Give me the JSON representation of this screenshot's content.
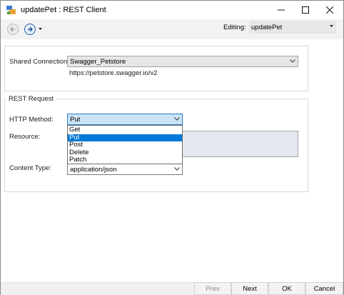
{
  "window": {
    "title": "updatePet : REST Client",
    "controls": {
      "minimize": "—",
      "maximize": "☐",
      "close": "✕"
    }
  },
  "toolbar": {
    "editing_label": "Editing:",
    "editing_value": "updatePet"
  },
  "connection": {
    "label": "Shared Connection:",
    "value": "Swagger_Petstore",
    "url": "https://petstore.swagger.io/v2"
  },
  "rest_request": {
    "title": "REST Request",
    "http_method_label": "HTTP Method:",
    "http_method_value": "Put",
    "resource_label": "Resource:",
    "content_type_label": "Content Type:",
    "content_type_value": "application/json",
    "method_options": [
      "Get",
      "Put",
      "Post",
      "Delete",
      "Patch"
    ],
    "selected_option_index": 1
  },
  "buttons": {
    "prev": "Prev",
    "next": "Next",
    "ok": "OK",
    "cancel": "Cancel"
  },
  "colors": {
    "accent": "#0078d7",
    "method_combo_bg": "#cce4f7",
    "resource_bg": "#e3e8ee"
  },
  "icons": {
    "app": "rest-client-app-icon",
    "back": "back-arrow-icon",
    "forward": "forward-arrow-icon",
    "dropdown": "chevron-down-icon"
  }
}
